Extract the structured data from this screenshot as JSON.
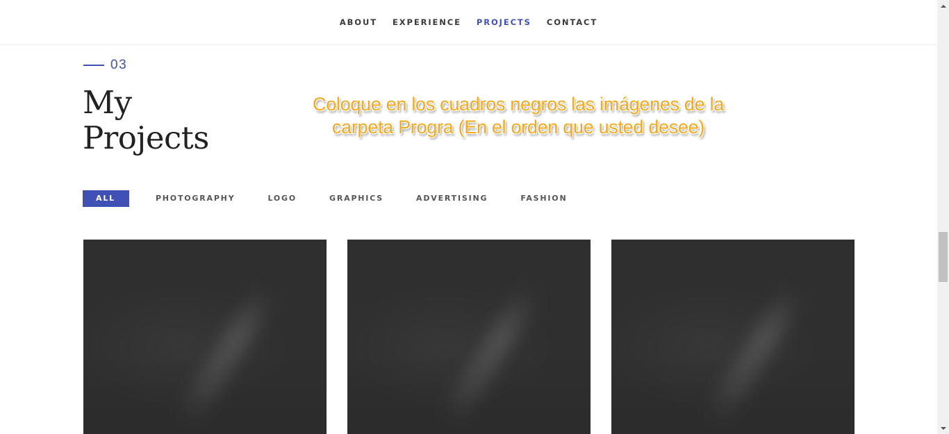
{
  "nav": {
    "items": [
      {
        "label": "ABOUT"
      },
      {
        "label": "EXPERIENCE"
      },
      {
        "label": "PROJECTS",
        "active": true
      },
      {
        "label": "CONTACT"
      }
    ]
  },
  "section": {
    "number": "03",
    "title_line1": "My",
    "title_line2": "Projects"
  },
  "overlay": {
    "line1": "Coloque en los cuadros negros las imágenes de la",
    "line2": "carpeta Progra (En el orden que usted desee)"
  },
  "filters": [
    {
      "label": "ALL",
      "active": true
    },
    {
      "label": "PHOTOGRAPHY"
    },
    {
      "label": "LOGO"
    },
    {
      "label": "GRAPHICS"
    },
    {
      "label": "ADVERTISING"
    },
    {
      "label": "FASHION"
    }
  ],
  "colors": {
    "accent": "#3f51b5",
    "overlay_text": "#f5a91b",
    "card_bg": "#2f2f2f"
  }
}
